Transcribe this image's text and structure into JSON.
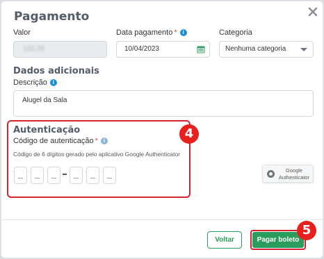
{
  "modal": {
    "title": "Pagamento",
    "close_icon": "close-icon"
  },
  "fields": {
    "valor_label": "Valor",
    "valor_value": "132,29",
    "data_label": "Data pagamento",
    "data_required": "*",
    "data_value": "10/04/2023",
    "categoria_label": "Categoria",
    "categoria_value": "Nenhuma categoria"
  },
  "dados": {
    "section_title": "Dados adicionais",
    "descricao_label": "Descrição",
    "descricao_value": "Alugel da Sala"
  },
  "auth": {
    "section_title": "Autenticação",
    "code_label": "Código de autenticação",
    "code_required": "*",
    "hint": "Código de 6 dígitos gerado pelo aplicativo Google Authenticator",
    "digits": [
      "",
      "",
      "",
      "",
      "",
      ""
    ],
    "google_button_line1": "Google",
    "google_button_line2": "Authenticator"
  },
  "annotations": {
    "badge_4": "4",
    "badge_5": "5",
    "badge_color": "#e8201d"
  },
  "footer": {
    "voltar_label": "Voltar",
    "pagar_label": "Pagar boleto"
  },
  "colors": {
    "accent_green": "#2a9d5c",
    "info_blue": "#1a8fd8",
    "highlight_red": "#d92030"
  }
}
